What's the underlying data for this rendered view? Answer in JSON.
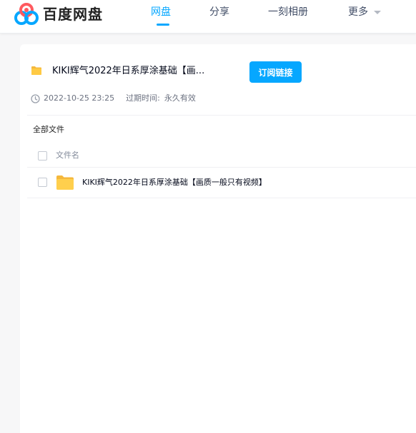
{
  "header": {
    "logo_text": "百度网盘",
    "nav": [
      {
        "label": "网盘",
        "active": true
      },
      {
        "label": "分享",
        "active": false
      },
      {
        "label": "一刻相册",
        "active": false
      },
      {
        "label": "更多",
        "active": false
      }
    ],
    "accent_color": "#06a7ff"
  },
  "share": {
    "title": "KIKI辉气2022年日系厚涂基础【画...",
    "subscribe_label": "订阅链接",
    "date": "2022-10-25 23:25",
    "expiry_label": "过期时间:",
    "expiry_value": "永久有效",
    "breadcrumb": "全部文件"
  },
  "file_list": {
    "column_name": "文件名",
    "rows": [
      {
        "icon": "folder-icon",
        "name": "KIKI辉气2022年日系厚涂基础【画质一般只有视频】"
      }
    ]
  }
}
